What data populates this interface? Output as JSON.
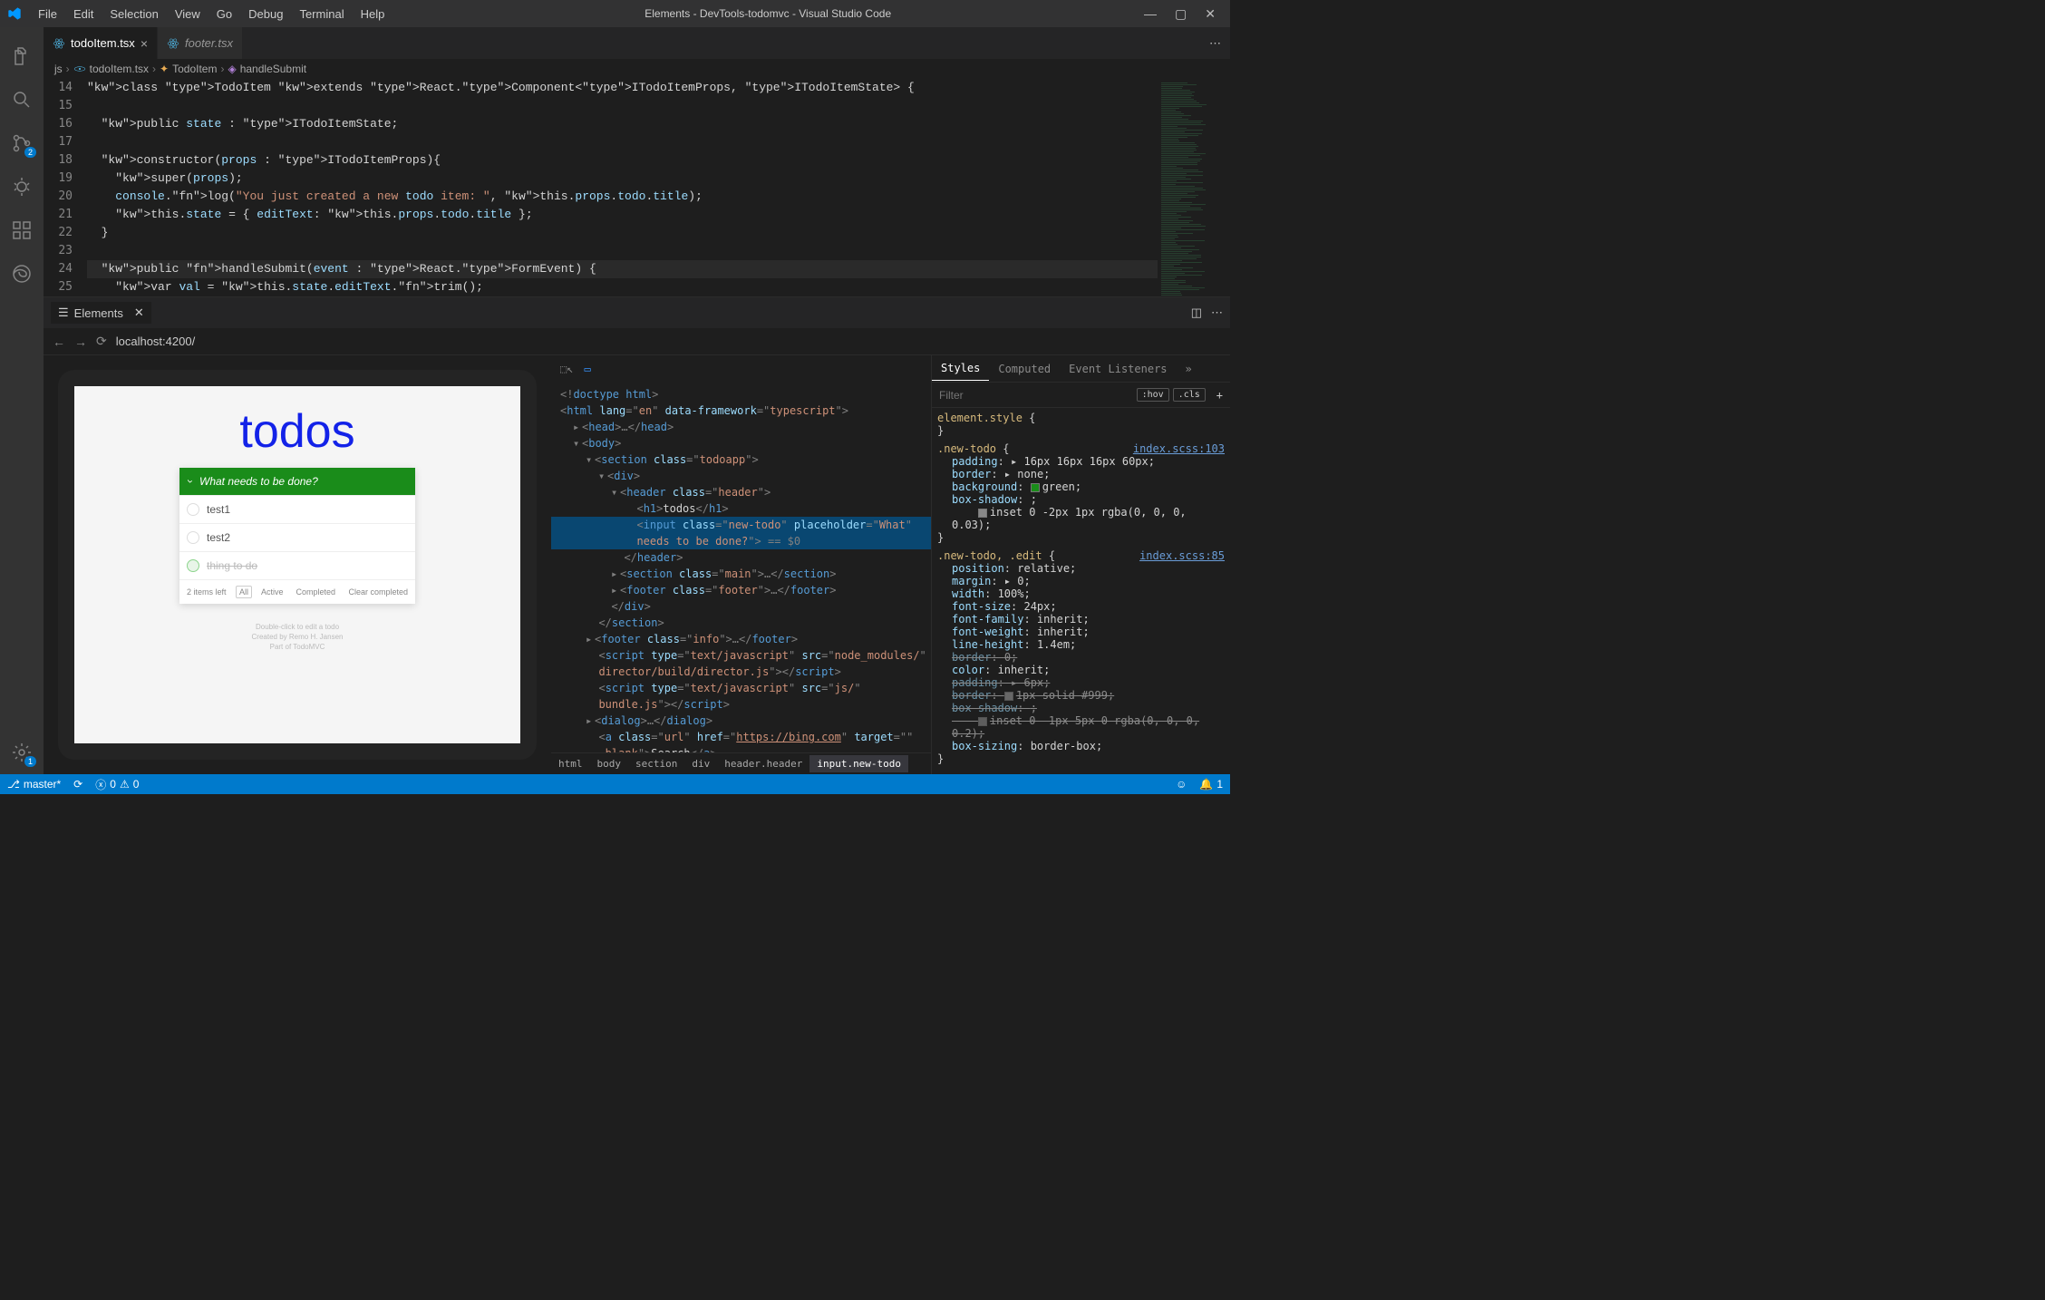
{
  "titlebar": {
    "menus": [
      "File",
      "Edit",
      "Selection",
      "View",
      "Go",
      "Debug",
      "Terminal",
      "Help"
    ],
    "title": "Elements - DevTools-todomvc - Visual Studio Code"
  },
  "activitybar": {
    "scm_badge": "2",
    "settings_badge": "1"
  },
  "tabs": {
    "active": "todoItem.tsx",
    "inactive": "footer.tsx"
  },
  "breadcrumbs": {
    "root": "js",
    "file": "todoItem.tsx",
    "class": "TodoItem",
    "method": "handleSubmit"
  },
  "editor": {
    "lines_start": 14,
    "lines": [
      {
        "n": 14,
        "raw": "class TodoItem extends React.Component<ITodoItemProps, ITodoItemState> {"
      },
      {
        "n": 15,
        "raw": ""
      },
      {
        "n": 16,
        "raw": "  public state : ITodoItemState;"
      },
      {
        "n": 17,
        "raw": ""
      },
      {
        "n": 18,
        "raw": "  constructor(props : ITodoItemProps){"
      },
      {
        "n": 19,
        "raw": "    super(props);"
      },
      {
        "n": 20,
        "raw": "    console.log(\"You just created a new todo item: \", this.props.todo.title);"
      },
      {
        "n": 21,
        "raw": "    this.state = { editText: this.props.todo.title };"
      },
      {
        "n": 22,
        "raw": "  }"
      },
      {
        "n": 23,
        "raw": ""
      },
      {
        "n": 24,
        "raw": "  public handleSubmit(event : React.FormEvent) {"
      },
      {
        "n": 25,
        "raw": "    var val = this.state.editText.trim();"
      }
    ]
  },
  "panel": {
    "title": "Elements",
    "url": "localhost:4200/"
  },
  "preview": {
    "heading": "todos",
    "placeholder": "What needs to be done?",
    "items": [
      {
        "label": "test1",
        "completed": false
      },
      {
        "label": "test2",
        "completed": false
      },
      {
        "label": "thing to do",
        "completed": true
      }
    ],
    "footer": {
      "count": "2 items left",
      "filters": [
        "All",
        "Active",
        "Completed"
      ],
      "clear": "Clear completed"
    },
    "credits": [
      "Double-click to edit a todo",
      "Created by Remo H. Jansen",
      "Part of TodoMVC"
    ]
  },
  "dom": {
    "doctype": "<!doctype html>",
    "html_attrs": {
      "lang": "en",
      "data-framework": "typescript"
    },
    "h1_text": "todos",
    "input_class": "new-todo",
    "input_placeholder": "What needs to be done?",
    "input_eq": "== $0",
    "section_main": "main",
    "footer_class": "footer",
    "info_class": "info",
    "script1_src": "node_modules/director/build/director.js",
    "script2_src": "js/bundle.js",
    "a_href": "https://bing.com",
    "a_target": "_blank",
    "a_text": "Search",
    "crumbs": [
      "html",
      "body",
      "section",
      "div",
      "header.header",
      "input.new-todo"
    ]
  },
  "styles": {
    "tabs": [
      "Styles",
      "Computed",
      "Event Listeners"
    ],
    "filter_placeholder": "Filter",
    "hov": ":hov",
    "cls": ".cls",
    "element_style": "element.style {",
    "rules": [
      {
        "selector": ".new-todo {",
        "source": "index.scss:103",
        "props": [
          {
            "name": "padding",
            "value": "16px 16px 16px 60px",
            "twist": true
          },
          {
            "name": "border",
            "value": "none",
            "twist": true
          },
          {
            "name": "background",
            "value": "green",
            "swatch": "#1a8c1a"
          },
          {
            "name": "box-shadow",
            "value": ""
          },
          {
            "name": "",
            "value": "inset 0 -2px 1px rgba(0, 0, 0, 0.03)",
            "indent": true,
            "swatch": "#888"
          }
        ]
      },
      {
        "selector": ".new-todo, .edit {",
        "source": "index.scss:85",
        "props": [
          {
            "name": "position",
            "value": "relative"
          },
          {
            "name": "margin",
            "value": "0",
            "twist": true
          },
          {
            "name": "width",
            "value": "100%"
          },
          {
            "name": "font-size",
            "value": "24px"
          },
          {
            "name": "font-family",
            "value": "inherit"
          },
          {
            "name": "font-weight",
            "value": "inherit"
          },
          {
            "name": "line-height",
            "value": "1.4em"
          },
          {
            "name": "border",
            "value": "0",
            "strike": true
          },
          {
            "name": "color",
            "value": "inherit"
          },
          {
            "name": "padding",
            "value": "6px",
            "strike": true,
            "twist": true
          },
          {
            "name": "border",
            "value": "1px solid #999",
            "strike": true,
            "swatch": "#999"
          },
          {
            "name": "box-shadow",
            "value": "",
            "strike": true
          },
          {
            "name": "",
            "value": "inset 0 -1px 5px 0 rgba(0, 0, 0, 0.2)",
            "indent": true,
            "strike": true,
            "swatch": "#888"
          },
          {
            "name": "box-sizing",
            "value": "border-box"
          }
        ]
      }
    ]
  },
  "statusbar": {
    "branch": "master*",
    "errors": "0",
    "warnings": "0",
    "bell": "1"
  }
}
